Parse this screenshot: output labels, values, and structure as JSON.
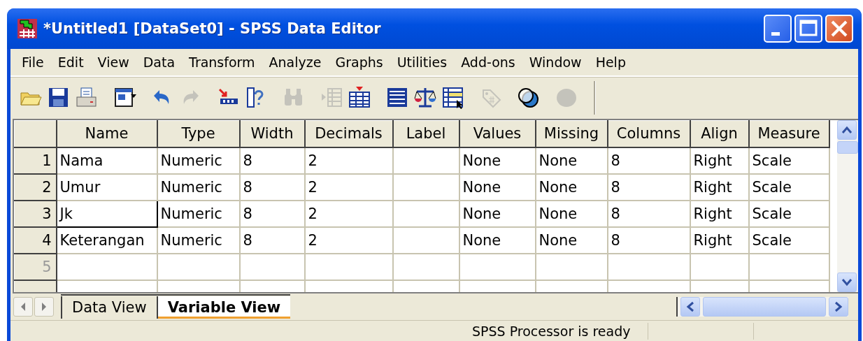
{
  "window": {
    "title": "*Untitled1 [DataSet0] - SPSS Data Editor"
  },
  "menu": [
    "File",
    "Edit",
    "View",
    "Data",
    "Transform",
    "Analyze",
    "Graphs",
    "Utilities",
    "Add-ons",
    "Window",
    "Help"
  ],
  "toolbar": [
    [
      {
        "kind": "folder",
        "disabled": false
      },
      {
        "kind": "save",
        "disabled": false
      },
      {
        "kind": "print",
        "disabled": false
      }
    ],
    [
      {
        "kind": "dialog",
        "disabled": false
      }
    ],
    [
      {
        "kind": "undo",
        "disabled": false
      },
      {
        "kind": "redo",
        "disabled": true
      }
    ],
    [
      {
        "kind": "goto",
        "disabled": false
      },
      {
        "kind": "variables",
        "disabled": false
      }
    ],
    [
      {
        "kind": "find",
        "disabled": true
      }
    ],
    [
      {
        "kind": "insertrow",
        "disabled": true
      },
      {
        "kind": "insertcol",
        "disabled": false
      }
    ],
    [
      {
        "kind": "split",
        "disabled": false
      },
      {
        "kind": "weight",
        "disabled": false
      },
      {
        "kind": "select",
        "disabled": false
      }
    ],
    [
      {
        "kind": "tag",
        "disabled": true
      }
    ],
    [
      {
        "kind": "sets",
        "disabled": false
      }
    ],
    [
      {
        "kind": "blob",
        "disabled": true
      }
    ]
  ],
  "table": {
    "columns": [
      "Name",
      "Type",
      "Width",
      "Decimals",
      "Label",
      "Values",
      "Missing",
      "Columns",
      "Align",
      "Measure"
    ],
    "rows": [
      {
        "number": "1",
        "empty": false,
        "focused": false,
        "cells": [
          "Nama",
          "Numeric",
          "8",
          "2",
          "",
          "None",
          "None",
          "8",
          "Right",
          "Scale"
        ]
      },
      {
        "number": "2",
        "empty": false,
        "focused": false,
        "cells": [
          "Umur",
          "Numeric",
          "8",
          "2",
          "",
          "None",
          "None",
          "8",
          "Right",
          "Scale"
        ]
      },
      {
        "number": "3",
        "empty": false,
        "focused": true,
        "cells": [
          "Jk",
          "Numeric",
          "8",
          "2",
          "",
          "None",
          "None",
          "8",
          "Right",
          "Scale"
        ]
      },
      {
        "number": "4",
        "empty": false,
        "focused": false,
        "cells": [
          "Keterangan",
          "Numeric",
          "8",
          "2",
          "",
          "None",
          "None",
          "8",
          "Right",
          "Scale"
        ]
      },
      {
        "number": "5",
        "empty": true,
        "focused": false
      }
    ]
  },
  "tabs": [
    {
      "label": "Data View",
      "selected": false
    },
    {
      "label": "Variable View",
      "selected": true
    }
  ],
  "status_bar": {
    "text": "SPSS Processor is ready"
  }
}
